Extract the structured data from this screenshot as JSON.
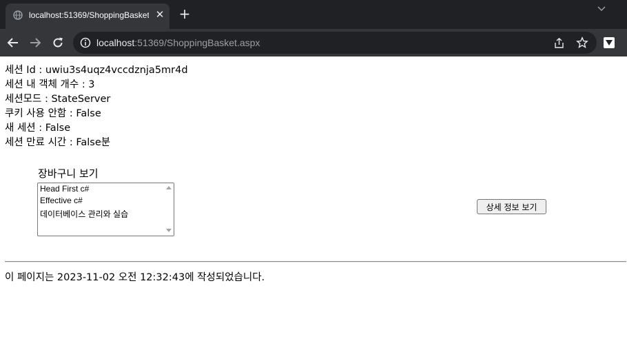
{
  "browser": {
    "tab_title": "localhost:51369/ShoppingBasket.aspx",
    "url_host": "localhost",
    "url_rest": ":51369/ShoppingBasket.aspx",
    "new_tab_label": "+",
    "close_label": "✕"
  },
  "session": {
    "lines": [
      "세션 Id : uwiu3s4uqz4vccdznja5mr4d",
      "세션 내 객체 개수 : 3",
      "세션모드 : StateServer",
      "쿠키 사용 안함 : False",
      "새 세션 : False",
      "세션 만료 시간 : False분"
    ]
  },
  "basket": {
    "label": "장바구니 보기",
    "items": [
      "Head First c#",
      "Effective c#",
      "데이터베이스 관리와 실습"
    ]
  },
  "detail_button": "상세 정보 보기",
  "footer": "이 페이지는 2023-11-02 오전 12:32:43에 작성되었습니다."
}
